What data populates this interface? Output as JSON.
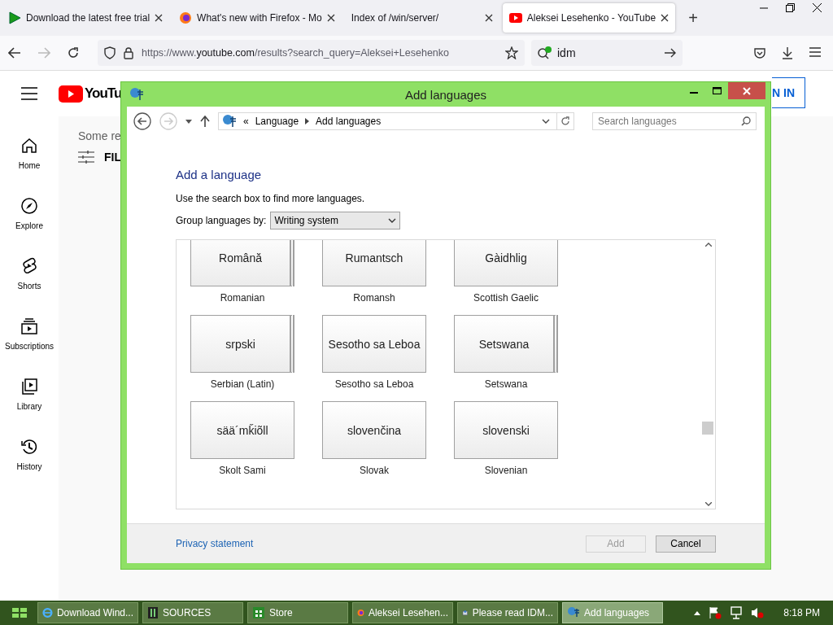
{
  "browser": {
    "tabs": [
      {
        "title": "Download the latest free trial",
        "selected": false
      },
      {
        "title": "What's new with Firefox - Mo",
        "selected": false
      },
      {
        "title": "Index of /win/server/",
        "selected": false
      },
      {
        "title": "Aleksei Lesehenko - YouTube",
        "selected": true
      }
    ],
    "new_tab": "+",
    "url": {
      "prefix": "https://www.",
      "domain": "youtube.com",
      "path": "/results?search_query=Aleksei+Lesehenko"
    },
    "search_value": "idm"
  },
  "youtube": {
    "logo": "YouTu",
    "results_text": "Some re",
    "filter_text": "FIL",
    "sign_in": "N IN",
    "sidebar": [
      {
        "label": "Home"
      },
      {
        "label": "Explore"
      },
      {
        "label": "Shorts"
      },
      {
        "label": "Subscriptions"
      },
      {
        "label": "Library"
      },
      {
        "label": "History"
      }
    ]
  },
  "dialog": {
    "title": "Add languages",
    "breadcrumb": [
      "«",
      "Language",
      "Add languages"
    ],
    "search_placeholder": "Search languages",
    "heading": "Add a language",
    "hint": "Use the search box to find more languages.",
    "group_label": "Group languages by:",
    "group_value": "Writing system",
    "languages": [
      {
        "native": "Română",
        "name": "Romanian",
        "stacked": true
      },
      {
        "native": "Rumantsch",
        "name": "Romansh",
        "stacked": false
      },
      {
        "native": "Gàidhlig",
        "name": "Scottish Gaelic",
        "stacked": false
      },
      {
        "native": "srpski",
        "name": "Serbian (Latin)",
        "stacked": true
      },
      {
        "native": "Sesotho sa Leboa",
        "name": "Sesotho sa Leboa",
        "stacked": false
      },
      {
        "native": "Setswana",
        "name": "Setswana",
        "stacked": true
      },
      {
        "native": "sää´mǩiõll",
        "name": "Skolt Sami",
        "stacked": false
      },
      {
        "native": "slovenčina",
        "name": "Slovak",
        "stacked": false
      },
      {
        "native": "slovenski",
        "name": "Slovenian",
        "stacked": false
      }
    ],
    "privacy_link": "Privacy statement",
    "buttons": [
      {
        "label": "Add",
        "disabled": true
      },
      {
        "label": "Cancel",
        "disabled": false
      }
    ]
  },
  "taskbar": {
    "items": [
      {
        "label": "Download Wind...",
        "selected": false
      },
      {
        "label": "SOURCES",
        "selected": false
      },
      {
        "label": "Store",
        "selected": false
      },
      {
        "label": "Aleksei Lesehen...",
        "selected": false
      },
      {
        "label": "Please read IDM...",
        "selected": false
      },
      {
        "label": "Add languages",
        "selected": true
      }
    ],
    "time": "8:18 PM"
  }
}
